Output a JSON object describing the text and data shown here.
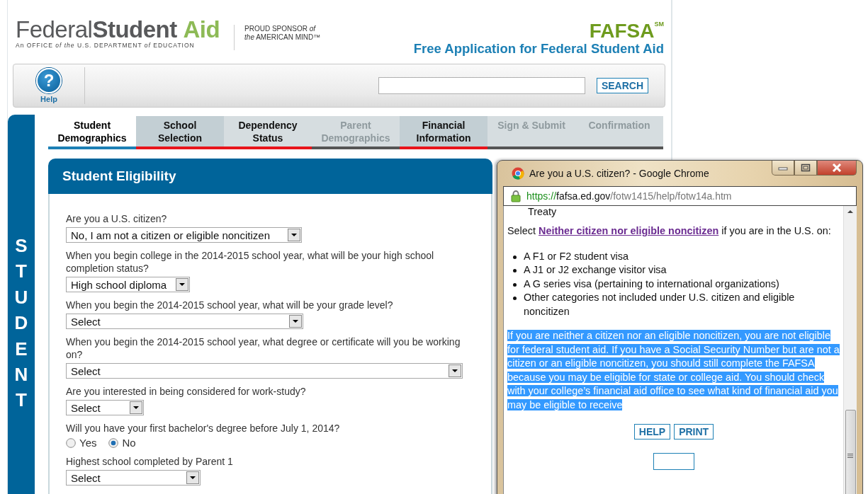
{
  "header": {
    "logo_light": "Federal",
    "logo_bold": "Student",
    "logo_accent": "Aid",
    "logo_tagline": "An OFFICE *of the* U.S. DEPARTMENT *of* EDUCATION",
    "sponsor_line_1": "PROUD SPONSOR *of*",
    "sponsor_line_2": "*the* AMERICAN MIND™",
    "fafsa_logo": "FAFSA$^{SM}$",
    "fafsa_subtitle": "Free Application for Federal Student Aid"
  },
  "toolbar": {
    "help_glyph": "?",
    "help_label": "Help",
    "search_button": "SEARCH"
  },
  "sidebar_label": "STUDENT",
  "tabs": [
    {
      "label": "Student Demographics",
      "selected": true,
      "disabled": false,
      "shaded": false,
      "incomplete": false
    },
    {
      "label": "School Selection",
      "selected": false,
      "disabled": false,
      "shaded": true,
      "incomplete": true
    },
    {
      "label": "Dependency Status",
      "selected": false,
      "disabled": false,
      "shaded": false,
      "incomplete": true
    },
    {
      "label": "Parent Demographics",
      "selected": false,
      "disabled": true,
      "shaded": false,
      "incomplete": false
    },
    {
      "label": "Financial Information",
      "selected": false,
      "disabled": false,
      "shaded": true,
      "incomplete": true
    },
    {
      "label": "Sign & Submit",
      "selected": false,
      "disabled": true,
      "shaded": false,
      "incomplete": false
    },
    {
      "label": "Confirmation",
      "selected": false,
      "disabled": true,
      "shaded": false,
      "incomplete": false
    }
  ],
  "panel": {
    "title": "Student Eligibility",
    "questions": [
      {
        "kind": "select",
        "label": "Are you a U.S. citizen?",
        "value": "No, I am not a citizen or eligible noncitizen"
      },
      {
        "kind": "select",
        "label": "When you begin college in the 2014-2015 school year, what will be your high school completion status?",
        "value": "High school diploma"
      },
      {
        "kind": "select",
        "label": "When you begin the 2014-2015 school year, what will be your grade level?",
        "value": "Select"
      },
      {
        "kind": "select",
        "label": "When you begin the 2014-2015 school year, what degree or certificate will you be working on?",
        "value": "Select"
      },
      {
        "kind": "select",
        "label": "Are you interested in being considered for work-study?",
        "value": "Select"
      },
      {
        "kind": "radio",
        "label": "Will you have your first bachelor's degree before July 1, 2014?",
        "options": [
          {
            "label": "Yes",
            "selected": false
          },
          {
            "label": "No",
            "selected": true
          }
        ]
      },
      {
        "kind": "select",
        "label": "Highest school completed by Parent 1",
        "value": "Select"
      }
    ]
  },
  "popup": {
    "title": "Are you a U.S. citizen? - Google Chrome",
    "url_scheme": "https://",
    "url_host": "fafsa.ed.gov",
    "url_path": "/fotw1415/help/fotw14a.htm",
    "cut_text": "Treaty",
    "intro_before": "Select",
    "intro_link": "Neither citizen nor eligible noncitizen",
    "intro_after": "if you are in the U.S. on:",
    "list": [
      "A F1 or F2 student visa",
      "A J1 or J2 exchange visitor visa",
      "A G series visa (pertaining to international organizations)",
      "Other categories not included under U.S. citizen and eligible noncitizen"
    ],
    "highlighted_text": "If you are neither a citizen nor an eligible noncitizen, you are not eligible for federal student aid. If you have a Social Security Number but are not a citizen or an eligible noncitizen, you should still complete the FAFSA because you may be eligible for state or college aid. You should check with your college’s financial aid office to see what kind of financial aid you may be eligible to receive",
    "buttons": [
      "HELP",
      "PRINT"
    ]
  }
}
